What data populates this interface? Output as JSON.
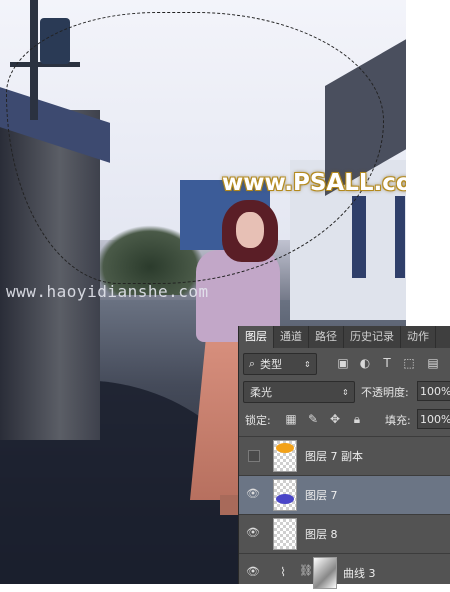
{
  "canvas": {
    "watermark": "www.PSALL.com",
    "site_text": "www.haoyidianshe.com"
  },
  "layers_panel": {
    "tabs": [
      "图层",
      "通道",
      "路径",
      "历史记录",
      "动作"
    ],
    "active_tab": "图层",
    "filter_kind": "类型",
    "blend_mode": "柔光",
    "opacity_label": "不透明度:",
    "opacity_value": "100%",
    "lock_label": "锁定:",
    "fill_label": "填充:",
    "fill_value": "100%",
    "layers": [
      {
        "name": "图层 7 副本",
        "visible": false,
        "selected": false,
        "thumb_color": "#f2a21a"
      },
      {
        "name": "图层 7",
        "visible": true,
        "selected": true,
        "thumb_color": "#4a46c8"
      },
      {
        "name": "图层 8",
        "visible": true,
        "selected": false,
        "thumb_color": ""
      },
      {
        "name": "曲线 3",
        "visible": true,
        "selected": false,
        "type": "adjustment-curves"
      }
    ]
  }
}
